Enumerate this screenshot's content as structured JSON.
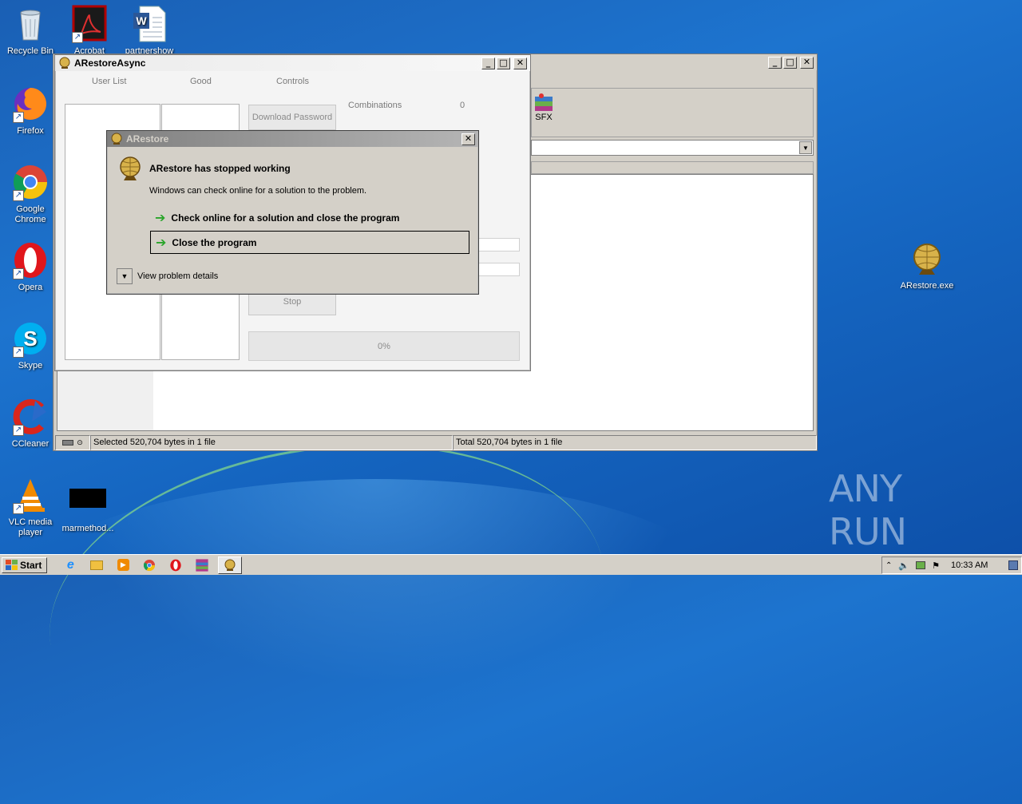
{
  "colors": {
    "desktop": "#1a66c2",
    "dialog_title_active": "#0a246a",
    "dialog_title_inactive": "#808080",
    "green_arrow": "#2aa52a"
  },
  "desktop": {
    "icons": [
      {
        "label": "Recycle Bin",
        "icon": "recycle-bin-icon"
      },
      {
        "label": "Acrobat",
        "icon": "acrobat-icon"
      },
      {
        "label": "partnershow",
        "icon": "word-doc-icon"
      },
      {
        "label": "Firefox",
        "icon": "firefox-icon"
      },
      {
        "label": "Google Chrome",
        "icon": "chrome-icon"
      },
      {
        "label": "Opera",
        "icon": "opera-icon"
      },
      {
        "label": "Skype",
        "icon": "skype-icon"
      },
      {
        "label": "CCleaner",
        "icon": "ccleaner-icon"
      },
      {
        "label": "VLC media player",
        "icon": "vlc-icon"
      },
      {
        "label": "marmethod...",
        "icon": "black-file-icon"
      },
      {
        "label": "ARestore.exe",
        "icon": "arestore-globe-icon"
      }
    ],
    "watermark": "ANY RUN"
  },
  "back_window": {
    "sfx_label": "SFX",
    "status_left": "Selected 520,704 bytes in 1 file",
    "status_right": "Total 520,704 bytes in 1 file"
  },
  "arestore_window": {
    "title": "ARestoreAsync",
    "columns": [
      "User List",
      "Good",
      "Controls"
    ],
    "download_button": "Download Password",
    "stop_button": "Stop",
    "combinations_label": "Combinations",
    "combinations_value": "0",
    "progress_label": "0%",
    "progress_value": 0
  },
  "error_dialog": {
    "title": "ARestore",
    "heading": "ARestore has stopped working",
    "message": "Windows can check online for a solution to the problem.",
    "option_check": "Check online for a solution and close the program",
    "option_close": "Close the program",
    "details": "View problem details"
  },
  "taskbar": {
    "start": "Start",
    "items": [
      "ie-icon",
      "explorer-icon",
      "media-player-icon",
      "chrome-icon",
      "opera-icon",
      "winrar-icon",
      "arestore-icon"
    ],
    "clock": "10:33 AM"
  }
}
